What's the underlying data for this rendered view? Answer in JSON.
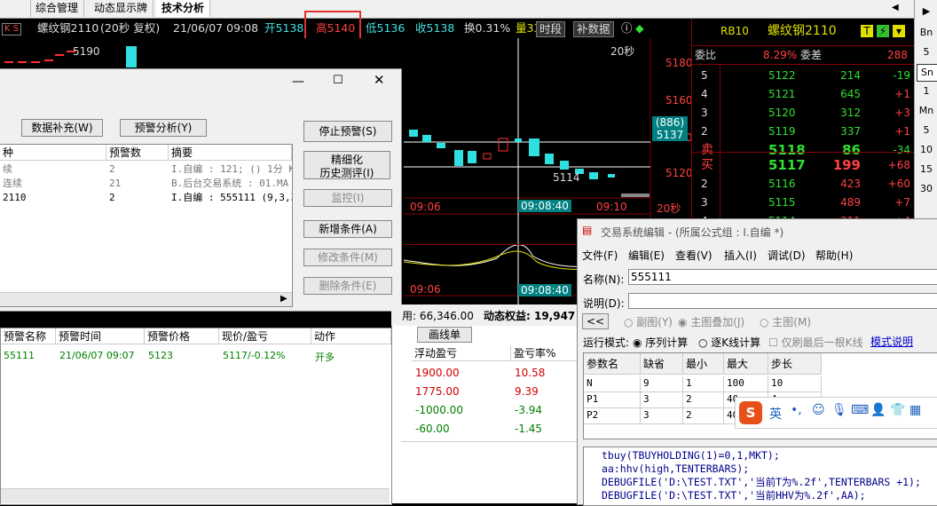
{
  "tabs": [
    "综合管理",
    "动态显示牌",
    "技术分析"
  ],
  "quote_bar": {
    "flags": "K S",
    "symbol": "螺纹钢2110",
    "period": "(20秒 复权)",
    "datetime": "21/06/07 09:08",
    "open": "开5138",
    "high": "高5140",
    "low": "低5136",
    "close": "收5138",
    "turnover": "换0.31%",
    "volume": "量33",
    "btn_period": "时段",
    "btn_data": "补数据"
  },
  "chart": {
    "price_ticks": [
      "5180",
      "5160",
      "5140",
      "5120"
    ],
    "cursor_box": [
      "(886)",
      "5137"
    ],
    "period_label": "20秒",
    "price_label_top": "5190",
    "low_label": "5114",
    "time_labels": [
      "09:06",
      "09:08:40",
      "09:10",
      "20秒"
    ],
    "time_labels2": [
      "09:06",
      "09:08:40"
    ],
    "colors": {
      "up": "#ff3030",
      "down": "#30e0e0",
      "grid": "#800000"
    }
  },
  "orderbook": {
    "code": "RB10",
    "name": "螺纹钢2110",
    "wb_label": "委比",
    "wb_value": "8.29%",
    "wc_label": "委差",
    "wc_value": "288",
    "asks": [
      {
        "lvl": "5",
        "price": "5122",
        "vol": "214",
        "chg": "-19"
      },
      {
        "lvl": "4",
        "price": "5121",
        "vol": "645",
        "chg": "+1"
      },
      {
        "lvl": "3",
        "price": "5120",
        "vol": "312",
        "chg": "+3"
      },
      {
        "lvl": "2",
        "price": "5119",
        "vol": "337",
        "chg": "+1"
      },
      {
        "lvl": "卖",
        "price": "5118",
        "vol": "86",
        "chg": "-34"
      }
    ],
    "bids": [
      {
        "lvl": "买",
        "price": "5117",
        "vol": "199",
        "chg": "+68"
      },
      {
        "lvl": "2",
        "price": "5116",
        "vol": "423",
        "chg": "+60"
      },
      {
        "lvl": "3",
        "price": "5115",
        "vol": "489",
        "chg": "+7"
      },
      {
        "lvl": "4",
        "price": "5114",
        "vol": "311",
        "chg": "+4"
      }
    ]
  },
  "sidebar": [
    "Bn",
    "5",
    "Sn",
    "1",
    "Mn",
    "5",
    "10",
    "15",
    "30"
  ],
  "alert_window": {
    "btn_supplement": "数据补充(W)",
    "btn_analysis": "预警分析(Y)",
    "btn_stop": "停止预警(S)",
    "btn_refine": [
      "精细化",
      "历史测评(I)"
    ],
    "btn_monitor": "监控(I)",
    "btn_add": "新增条件(A)",
    "btn_modify": "修改条件(M)",
    "btn_delete": "删除条件(E)",
    "cond_headers": [
      "种",
      "预警数",
      "摘要"
    ],
    "cond_rows": [
      [
        "续",
        "2",
        "I.自编 : 121; () 1分 K线"
      ],
      [
        "连续",
        "21",
        "B.后台交易系统 : 01.MA"
      ],
      [
        "2110",
        "2",
        "I.自编 : 555111 (9,3,3)"
      ]
    ],
    "log_headers": [
      "预警名称",
      "预警时间",
      "预警价格",
      "现价/盈亏",
      "动作"
    ],
    "log_rows": [
      [
        "55111",
        "21/06/07 09:07",
        "5123",
        "5117/-0.12%",
        "开多"
      ]
    ]
  },
  "account": {
    "equity_label": "用: 66,346.00",
    "dynamic_label": "动态权益: 19,947",
    "draw_line_btn": "画线单",
    "pl_headers": [
      "浮动盈亏",
      "盈亏率%"
    ],
    "pl_rows": [
      {
        "pl": "1900.00",
        "rate": "10.58",
        "color": "#d00000"
      },
      {
        "pl": "1775.00",
        "rate": "9.39",
        "color": "#d00000"
      },
      {
        "pl": "-1000.00",
        "rate": "-3.94",
        "color": "#008000"
      },
      {
        "pl": "-60.00",
        "rate": "-1.45",
        "color": "#008000"
      }
    ]
  },
  "editor_window": {
    "title": "交易系统编辑 - (所属公式组 : I.自编 *)",
    "menu": [
      "文件(F)",
      "编辑(E)",
      "查看(V)",
      "插入(I)",
      "调试(D)",
      "帮助(H)"
    ],
    "name_label": "名称(N):",
    "name_value": "555111",
    "desc_label": "说明(D):",
    "back_btn": "<<",
    "radio_sub": "副图(Y)",
    "radio_overlay": "主图叠加(J)",
    "radio_main": "主图(M)",
    "mode_label": "运行模式:",
    "mode_seq": "序列计算",
    "mode_tick": "逐K线计算",
    "last_bar": "仅刷最后一根K线",
    "mode_help": "模式说明",
    "param_headers": [
      "参数名",
      "缺省",
      "最小",
      "最大",
      "步长"
    ],
    "params": [
      [
        "N",
        "9",
        "1",
        "100",
        "10"
      ],
      [
        "P1",
        "3",
        "2",
        "40",
        "4"
      ],
      [
        "P2",
        "3",
        "2",
        "40",
        ""
      ]
    ],
    "code_lines": [
      "tbuy(TBUYHOLDING(1)=0,1,MKT);",
      "aa:hhv(high,TENTERBARS);",
      "DEBUGFILE('D:\\TEST.TXT','当前T为%.2f',TENTERBARS +1);",
      "DEBUGFILE('D:\\TEST.TXT','当前HHV为%.2f',AA);"
    ],
    "ime_label": "英"
  }
}
